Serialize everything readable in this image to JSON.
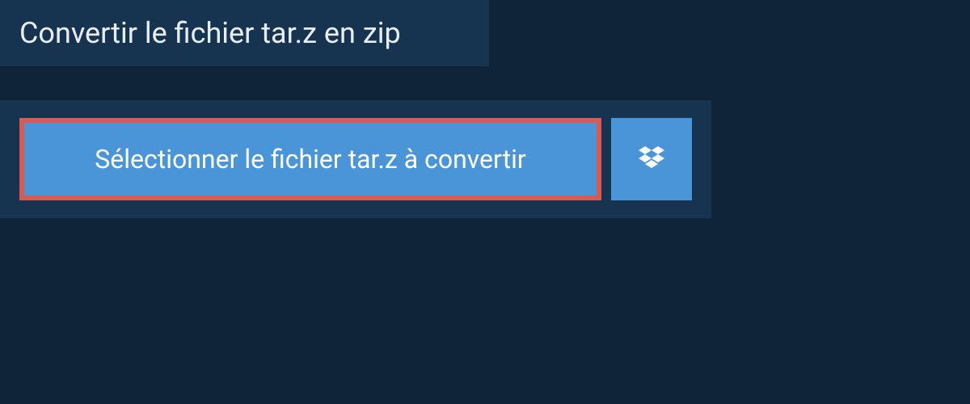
{
  "header": {
    "title": "Convertir le fichier tar.z en zip"
  },
  "actions": {
    "select_file_label": "Sélectionner le fichier tar.z à convertir",
    "dropbox_icon_name": "dropbox-icon"
  },
  "colors": {
    "background": "#0f2438",
    "panel": "#163450",
    "button_primary": "#4a94d8",
    "highlight_border": "#d85a52",
    "text": "#e8eef5"
  }
}
